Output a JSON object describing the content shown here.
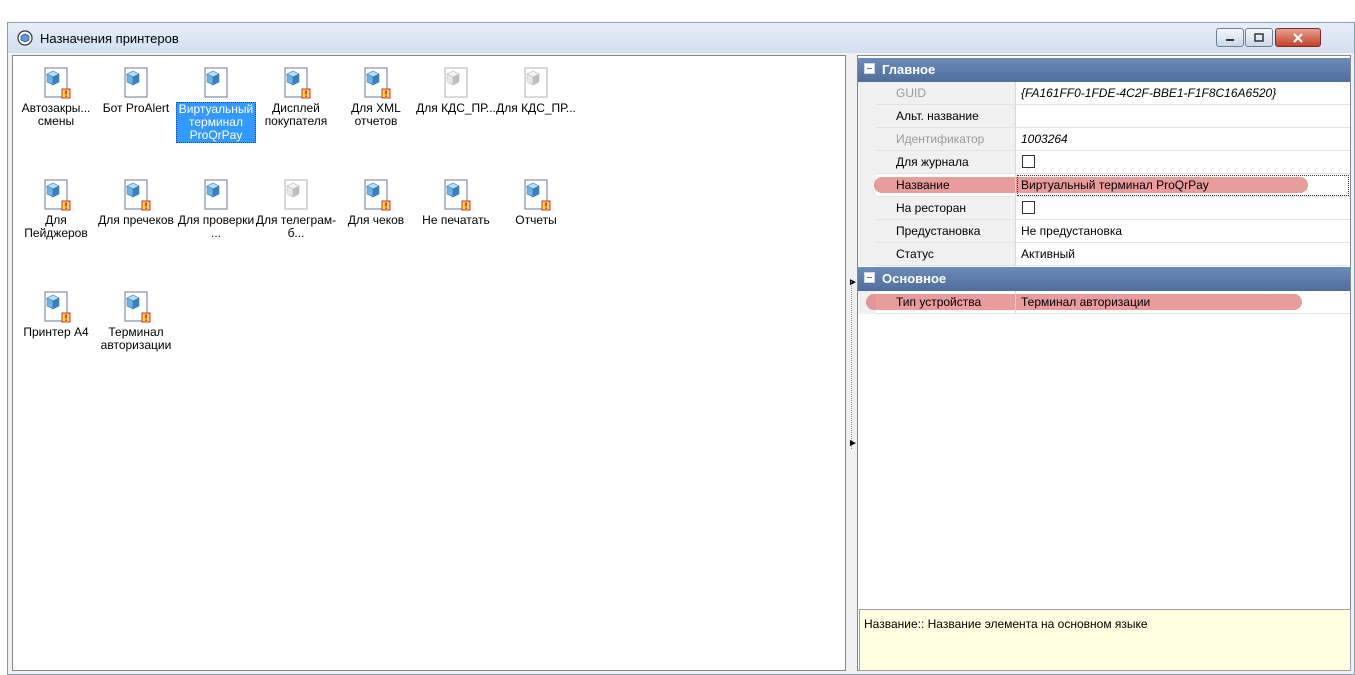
{
  "window": {
    "title": "Назначения принтеров",
    "icon": "printer-destination-icon"
  },
  "icons": [
    {
      "label": "Автозакры... смены",
      "icon": "printer-warning-icon",
      "state": "normal"
    },
    {
      "label": "Бот ProAlert",
      "icon": "printer-icon",
      "state": "normal"
    },
    {
      "label": "Виртуальный терминал ProQrPay",
      "icon": "printer-icon",
      "state": "selected"
    },
    {
      "label": "Дисплей покупателя",
      "icon": "printer-warning-icon",
      "state": "normal"
    },
    {
      "label": "Для XML отчетов",
      "icon": "printer-warning-icon",
      "state": "normal"
    },
    {
      "label": "Для КДС_ПР...",
      "icon": "printer-disabled-icon",
      "state": "disabled"
    },
    {
      "label": "Для КДС_ПР...",
      "icon": "printer-disabled-icon",
      "state": "disabled"
    },
    {
      "label": "Для Пейджеров",
      "icon": "printer-warning-icon",
      "state": "normal"
    },
    {
      "label": "Для пречеков",
      "icon": "printer-warning-icon",
      "state": "normal"
    },
    {
      "label": "Для проверки ...",
      "icon": "printer-icon",
      "state": "normal"
    },
    {
      "label": "Для телеграм-б...",
      "icon": "printer-disabled-icon",
      "state": "disabled"
    },
    {
      "label": "Для чеков",
      "icon": "printer-warning-icon",
      "state": "normal"
    },
    {
      "label": "Не печатать",
      "icon": "printer-warning-icon",
      "state": "normal"
    },
    {
      "label": "Отчеты",
      "icon": "printer-warning-icon",
      "state": "normal"
    },
    {
      "label": "Принтер А4",
      "icon": "printer-warning-icon",
      "state": "normal"
    },
    {
      "label": "Терминал авторизации",
      "icon": "printer-warning-icon",
      "state": "normal"
    }
  ],
  "props": {
    "cat_main": "Главное",
    "guid_name": "GUID",
    "guid_val": "{FA161FF0-1FDE-4C2F-BBE1-F1F8C16A6520}",
    "alt_name": "Альт. название",
    "alt_val": "",
    "id_name": "Идентификатор",
    "id_val": "1003264",
    "journal_name": "Для журнала",
    "title_name": "Название",
    "title_val": "Виртуальный терминал ProQrPay",
    "restaurant_name": "На ресторан",
    "preset_name": "Предустановка",
    "preset_val": "Не предустановка",
    "status_name": "Статус",
    "status_val": "Активный",
    "cat_basic": "Основное",
    "devtype_name": "Тип устройства",
    "devtype_val": "Терминал авторизации"
  },
  "description": "Название:: Название элемента на основном языке",
  "colors": {
    "category_header": "#5a79a8",
    "selection": "#3399ff",
    "highlight_marker": "#d74b4b",
    "description_bg": "#ffffe1"
  }
}
